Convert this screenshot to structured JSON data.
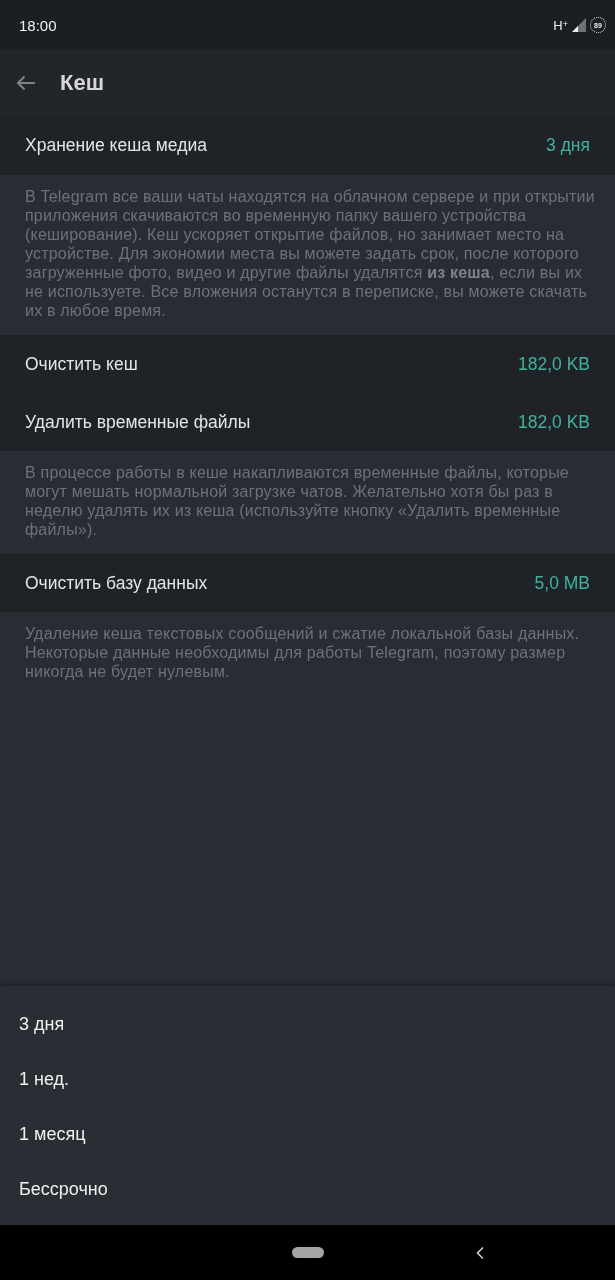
{
  "status_bar": {
    "time": "18:00",
    "network": "H$^{+}$",
    "battery": "89"
  },
  "toolbar": {
    "title": "Кеш"
  },
  "sections": [
    {
      "kind": "row",
      "label": "Хранение кеша медиа",
      "value": "3 дня"
    },
    {
      "kind": "info",
      "text": "В Telegram все ваши чаты находятся на облачном сервере и при открытии приложения скачиваются во временную папку вашего устройства (кеширование). Кеш ускоряет открытие файлов, но занимает место на устройстве. Для экономии места вы можете задать срок, после которого загруженные фото, видео и другие файлы удалятся **из кеша**, если вы их не используете. Все вложения останутся в переписке, вы можете скачать их в любое время."
    },
    {
      "kind": "row",
      "label": "Очистить кеш",
      "value": "182,0 KB"
    },
    {
      "kind": "row",
      "label": "Удалить временные файлы",
      "value": "182,0 KB"
    },
    {
      "kind": "info",
      "text": "В процессе работы в кеше накапливаются временные файлы, которые могут мешать нормальной загрузке чатов. Желательно хотя бы раз в неделю удалять их из кеша (используйте кнопку «Удалить временные файлы»)."
    },
    {
      "kind": "row",
      "label": "Очистить базу данных",
      "value": "5,0 MB"
    },
    {
      "kind": "info",
      "text": "Удаление кеша текстовых сообщений и сжатие локальной базы данных. Некоторые данные необходимы для работы Telegram, поэтому размер никогда не будет нулевым."
    }
  ],
  "bottom_sheet": {
    "options": [
      {
        "label": "3 дня"
      },
      {
        "label": "1 нед."
      },
      {
        "label": "1 месяц"
      },
      {
        "label": "Бессрочно"
      }
    ]
  }
}
